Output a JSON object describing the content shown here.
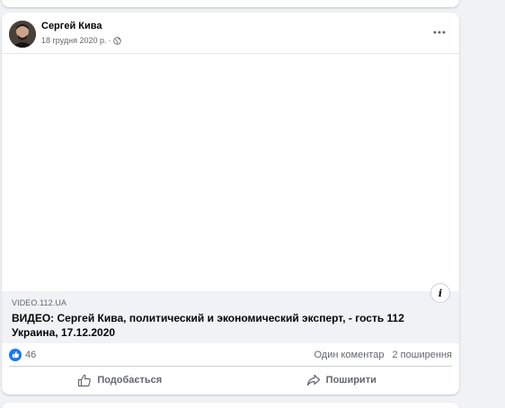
{
  "post": {
    "author": "Сергей Кива",
    "date": "18 грудня 2020 р.",
    "separator": "·",
    "privacy_icon": "globe-icon",
    "more_icon": "more-horizontal-icon",
    "link_preview": {
      "domain": "VIDEO.112.UA",
      "title": "ВИДЕО: Сергей Кива, политический и экономический эксперт, - гость 112 Украина, 17.12.2020"
    },
    "info_label": "i",
    "reactions": {
      "count": "46",
      "icon": "like-icon"
    },
    "comments_label": "Один коментар",
    "shares_label": "2 поширення",
    "actions": {
      "like_label": "Подобається",
      "share_label": "Поширити"
    }
  },
  "colors": {
    "background": "#f0f2f5",
    "card": "#ffffff",
    "primary_text": "#050505",
    "secondary_text": "#65676b",
    "like_blue": "#1877f2"
  }
}
